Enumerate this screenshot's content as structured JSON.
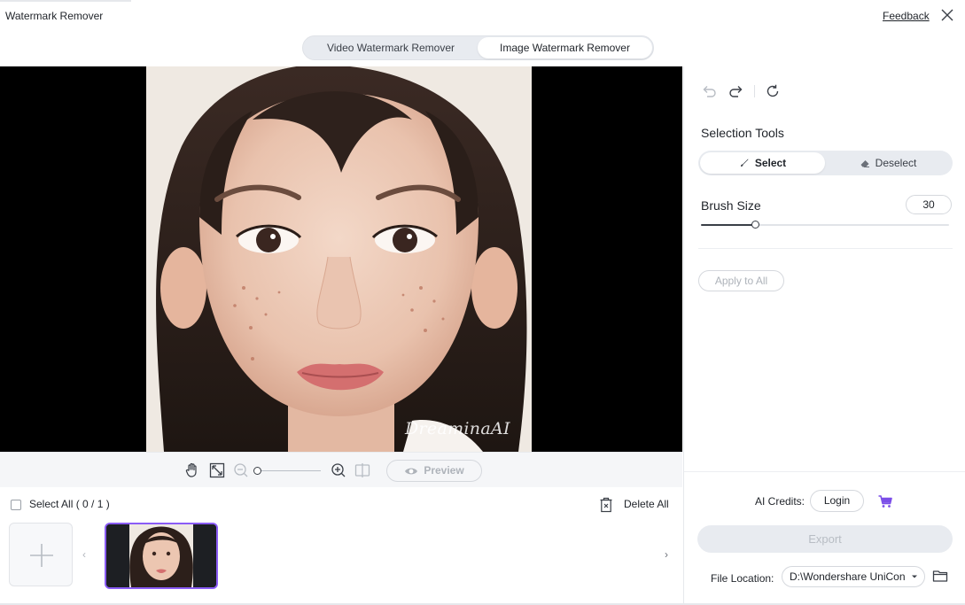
{
  "window": {
    "title": "Watermark Remover",
    "feedback_label": "Feedback"
  },
  "modes": {
    "video_label": "Video Watermark Remover",
    "image_label": "Image Watermark Remover",
    "active": "image"
  },
  "canvas": {
    "watermark_text": "DreaminaAI"
  },
  "zoombar": {
    "preview_label": "Preview"
  },
  "strip": {
    "select_all_label": "Select All ( 0 / 1 )",
    "delete_all_label": "Delete All",
    "prev_arrow": "‹",
    "next_arrow": "›"
  },
  "panel": {
    "selection_tools_title": "Selection Tools",
    "select_label": "Select",
    "deselect_label": "Deselect",
    "brush_size_label": "Brush Size",
    "brush_size_value": "30",
    "brush_size_fraction": 0.22,
    "apply_all_label": "Apply to All",
    "ai_credits_label": "AI Credits:",
    "login_label": "Login",
    "export_label": "Export",
    "file_location_label": "File Location:",
    "file_location_value": "D:\\Wondershare UniCon"
  },
  "colors": {
    "accent": "#8a5cf6",
    "cart": "#7b4ee8"
  }
}
